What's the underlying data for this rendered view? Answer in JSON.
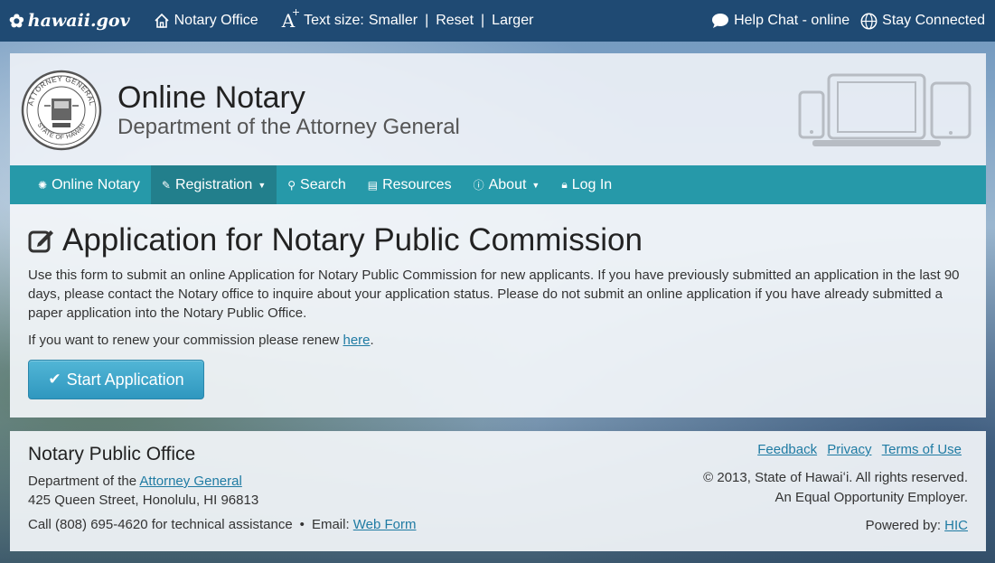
{
  "topbar": {
    "brand": "hawaii.gov",
    "notary_office": "Notary Office",
    "text_size_label": "Text size:",
    "smaller": "Smaller",
    "reset": "Reset",
    "larger": "Larger",
    "help_chat": "Help Chat - online",
    "stay_connected": "Stay Connected"
  },
  "header": {
    "title": "Online Notary",
    "subtitle": "Department of the Attorney General",
    "seal_text_top": "ATTORNEY GENERAL",
    "seal_text_bottom": "STATE OF HAWAII"
  },
  "nav": {
    "items": [
      {
        "label": "Online Notary",
        "icon": "asterisk-icon"
      },
      {
        "label": "Registration",
        "icon": "edit-icon",
        "dropdown": true,
        "active": true
      },
      {
        "label": "Search",
        "icon": "search-icon"
      },
      {
        "label": "Resources",
        "icon": "file-icon"
      },
      {
        "label": "About",
        "icon": "info-icon",
        "dropdown": true
      },
      {
        "label": "Log In",
        "icon": "lock-icon"
      }
    ]
  },
  "main": {
    "heading": "Application for Notary Public Commission",
    "lead": "Use this form to submit an online Application for Notary Public Commission for new applicants. If you have previously submitted an application in the last 90 days, please contact the Notary office to inquire about your application status. Please do not submit an online application if you have already submitted a paper application into the Notary Public Office.",
    "renew_text": "If you want to renew your commission please renew ",
    "renew_link": "here",
    "renew_end": ".",
    "start_button": "Start Application"
  },
  "footer": {
    "title": "Notary Public Office",
    "dept_prefix": "Department of the ",
    "dept_link": "Attorney General",
    "address": "425 Queen Street, Honolulu, HI 96813",
    "call": "Call (808) 695-4620 for technical assistance",
    "email_label": "Email: ",
    "email_link": "Web Form",
    "links": [
      "Feedback",
      "Privacy",
      "Terms of Use"
    ],
    "copyright": "© 2013, State of Hawaiʻi. All rights reserved.",
    "eeo": "An Equal Opportunity Employer.",
    "powered_label": "Powered by: ",
    "powered_link": "HIC"
  }
}
